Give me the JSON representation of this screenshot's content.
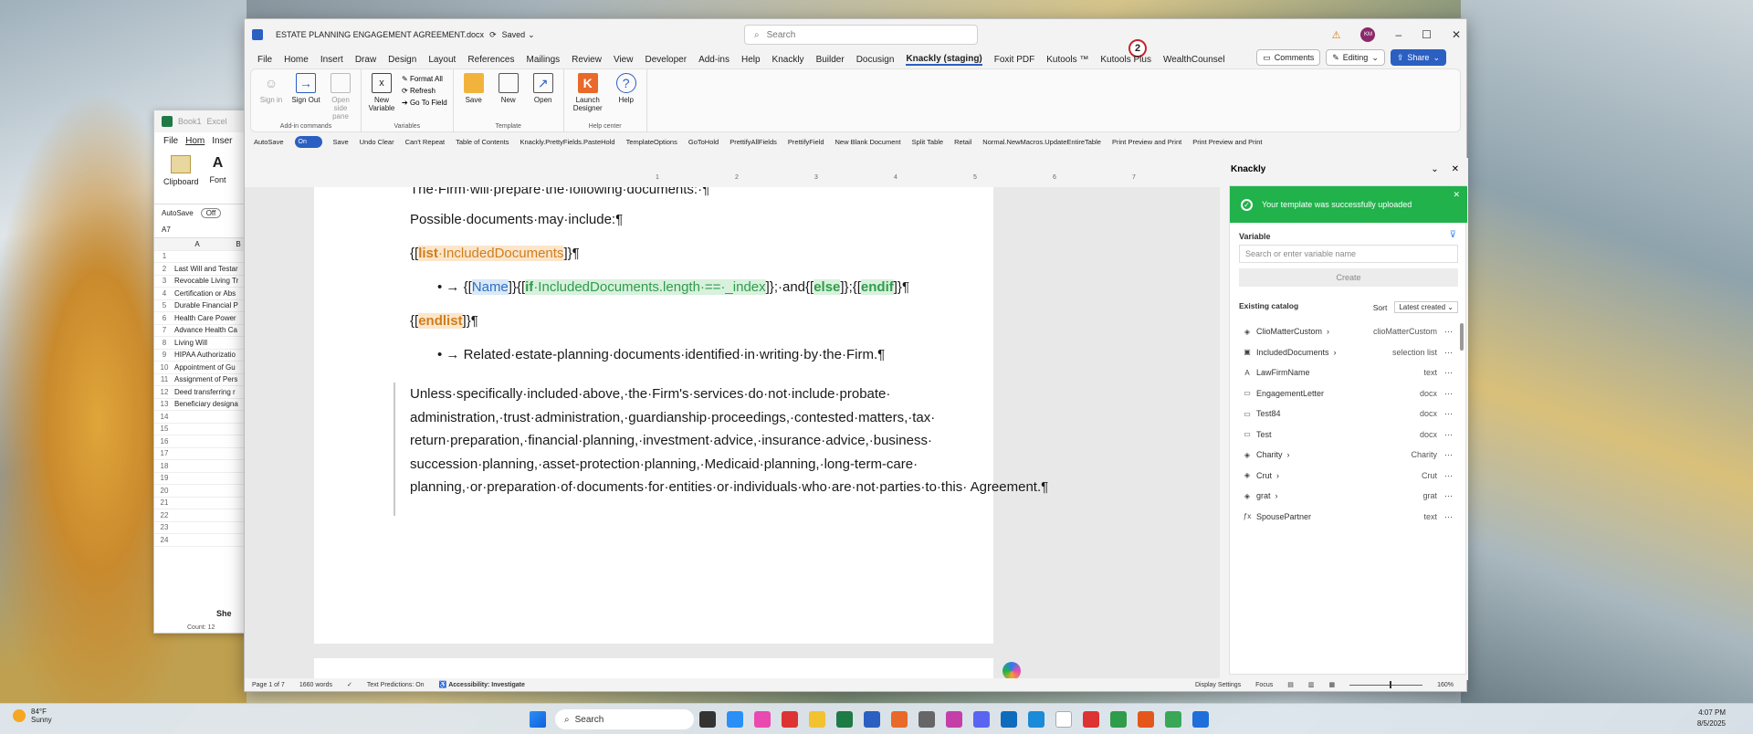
{
  "excel": {
    "title_1": "Book1",
    "title_2": "Excel",
    "tabs": [
      "File",
      "Hom",
      "Inser"
    ],
    "clipboard": "Clipboard",
    "font": "Font",
    "autosave": "AutoSave",
    "autosave_state": "Off",
    "cell_ref": "A7",
    "col_a": "A",
    "col_b": "B",
    "rows": [
      {
        "n": "1",
        "v": ""
      },
      {
        "n": "2",
        "v": "Last Will and Testar"
      },
      {
        "n": "3",
        "v": "Revocable Living Tr"
      },
      {
        "n": "4",
        "v": "Certification or Abs"
      },
      {
        "n": "5",
        "v": "Durable Financial P"
      },
      {
        "n": "6",
        "v": "Health Care Power"
      },
      {
        "n": "7",
        "v": "Advance Health Ca"
      },
      {
        "n": "8",
        "v": "Living Will"
      },
      {
        "n": "9",
        "v": "HIPAA Authorizatio"
      },
      {
        "n": "10",
        "v": "Appointment of Gu"
      },
      {
        "n": "11",
        "v": "Assignment of Pers"
      },
      {
        "n": "12",
        "v": "Deed transferring r"
      },
      {
        "n": "13",
        "v": "Beneficiary designa"
      },
      {
        "n": "14",
        "v": ""
      },
      {
        "n": "15",
        "v": ""
      },
      {
        "n": "16",
        "v": ""
      },
      {
        "n": "17",
        "v": ""
      },
      {
        "n": "18",
        "v": ""
      },
      {
        "n": "19",
        "v": ""
      },
      {
        "n": "20",
        "v": ""
      },
      {
        "n": "21",
        "v": ""
      },
      {
        "n": "22",
        "v": ""
      },
      {
        "n": "23",
        "v": ""
      },
      {
        "n": "24",
        "v": ""
      }
    ],
    "sheet": "She",
    "count": "Count: 12"
  },
  "word": {
    "doc_title": "ESTATE PLANNING ENGAGEMENT AGREEMENT.docx",
    "saved": "Saved",
    "search_placeholder": "Search",
    "avatar": "KM",
    "notification_count": "2",
    "menu": [
      "File",
      "Home",
      "Insert",
      "Draw",
      "Design",
      "Layout",
      "References",
      "Mailings",
      "Review",
      "View",
      "Developer",
      "Add-ins",
      "Help",
      "Knackly",
      "Builder",
      "Docusign",
      "Knackly (staging)",
      "Foxit PDF",
      "Kutools ™",
      "Kutools Plus",
      "WealthCounsel"
    ],
    "active_menu_index": 16,
    "comments": "Comments",
    "editing": "Editing",
    "share": "Share",
    "ribbon": {
      "addin": {
        "label": "Add-in commands",
        "sign_in": "Sign in",
        "sign_out": "Sign Out",
        "open_side_pane": "Open side pane"
      },
      "variables": {
        "label": "Variables",
        "new_variable": "New Variable",
        "format_all": "Format All",
        "refresh": "Refresh",
        "go_to_field": "Go To Field"
      },
      "template": {
        "label": "Template",
        "save": "Save",
        "new": "New",
        "open": "Open"
      },
      "help": {
        "label": "Help center",
        "launch_designer": "Launch Designer",
        "help": "Help"
      }
    },
    "qat": [
      "AutoSave",
      "On",
      "Save",
      "Undo Clear",
      "Can't Repeat",
      "Table of Contents",
      "Knackly.PrettyFields.PasteHold",
      "TemplateOptions",
      "GoToHold",
      "PrettifyAllFields",
      "PrettifyField",
      "New Blank Document",
      "Split Table",
      "Retail",
      "Normal.NewMacros.UpdateEntireTable",
      "Print Preview and Print",
      "Print Preview and Print"
    ],
    "ruler_marks": [
      "1",
      "2",
      "3",
      "4",
      "5",
      "6",
      "7"
    ],
    "doc": {
      "line1": "The·Firm·will·prepare·the·following·documents:·¶",
      "line2": "Possible·documents·may·include:¶",
      "l3_open": "{[",
      "l3_kw": "list",
      "l3_var": "·IncludedDocuments",
      "l3_close": "]}¶",
      "l4_bullet": "•  →  {[",
      "l4_name": "Name",
      "l4_mid1": "]}{[",
      "l4_if": "if",
      "l4_cond": "·IncludedDocuments.length·==·_index",
      "l4_mid2": "]};·and{[",
      "l4_else": "else",
      "l4_mid3": "]};{[",
      "l4_endif": "endif",
      "l4_end": "]}¶",
      "l5_open": "{[",
      "l5_kw": "endlist",
      "l5_close": "]}¶",
      "l6": "•  →  Related·estate-planning·documents·identified·in·writing·by·the·Firm.¶",
      "para": "Unless·specifically·included·above,·the·Firm's·services·do·not·include·probate· administration,·trust·administration,·guardianship·proceedings,·contested·matters,·tax· return·preparation,·financial·planning,·investment·advice,·insurance·advice,·business· succession·planning,·asset-protection·planning,·Medicaid·planning,·long-term-care· planning,·or·preparation·of·documents·for·entities·or·individuals·who·are·not·parties·to·this· Agreement.¶"
    },
    "status": {
      "page": "Page 1 of 7",
      "words": "1660 words",
      "text_predictions": "Text Predictions: On",
      "accessibility": "Accessibility: Investigate",
      "display_settings": "Display Settings",
      "focus": "Focus",
      "zoom": "160%"
    }
  },
  "knackly": {
    "title": "Knackly",
    "toast": "Your template was successfully uploaded",
    "variable_label": "Variable",
    "search_placeholder": "Search or enter variable name",
    "create": "Create",
    "catalog_title": "Existing catalog",
    "sort_label": "Sort",
    "sort_value": "Latest created",
    "items": [
      {
        "icon": "cube-icon",
        "glyph": "◈",
        "name": "ClioMatterCustom",
        "chev": "›",
        "type": "clioMatterCustom"
      },
      {
        "icon": "list-icon",
        "glyph": "▣",
        "name": "IncludedDocuments",
        "chev": "›",
        "type": "selection list"
      },
      {
        "icon": "text-icon",
        "glyph": "A",
        "name": "LawFirmName",
        "chev": "",
        "type": "text"
      },
      {
        "icon": "doc-icon",
        "glyph": "▭",
        "name": "EngagementLetter",
        "chev": "",
        "type": "docx"
      },
      {
        "icon": "doc-icon",
        "glyph": "▭",
        "name": "Test84",
        "chev": "",
        "type": "docx"
      },
      {
        "icon": "doc-icon",
        "glyph": "▭",
        "name": "Test",
        "chev": "",
        "type": "docx"
      },
      {
        "icon": "cube-icon",
        "glyph": "◈",
        "name": "Charity",
        "chev": "›",
        "type": "Charity"
      },
      {
        "icon": "cube-icon",
        "glyph": "◈",
        "name": "Crut",
        "chev": "›",
        "type": "Crut"
      },
      {
        "icon": "cube-icon",
        "glyph": "◈",
        "name": "grat",
        "chev": "›",
        "type": "grat"
      },
      {
        "icon": "fx-icon",
        "glyph": "ƒx",
        "name": "SpousePartner",
        "chev": "",
        "type": "text"
      }
    ]
  },
  "taskbar": {
    "temp": "84°F",
    "condition": "Sunny",
    "search": "Search",
    "time": "4:07 PM",
    "date": "8/5/2025"
  },
  "colors": {
    "word_blue": "#2b5fc1",
    "knackly_green": "#21b24b",
    "tag_orange": "#d07e1b",
    "tag_green": "#2f9c4a",
    "tag_blue": "#2b6fc7"
  }
}
